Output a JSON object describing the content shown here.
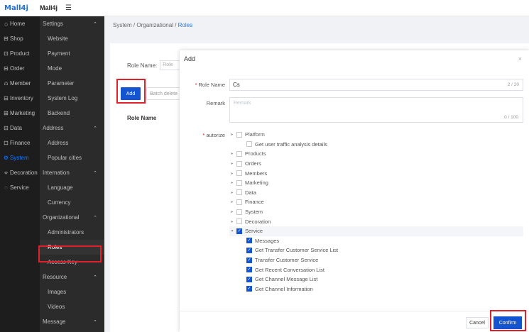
{
  "header": {
    "logo": "Mall4j",
    "brand": "Mall4j",
    "menu_toggle_icon": "hamburger-icon"
  },
  "primary_nav": [
    {
      "icon": "⌂",
      "label": "Home"
    },
    {
      "icon": "⊟",
      "label": "Shop"
    },
    {
      "icon": "⊡",
      "label": "Product"
    },
    {
      "icon": "⊟",
      "label": "Order"
    },
    {
      "icon": "⍝",
      "label": "Member"
    },
    {
      "icon": "⊟",
      "label": "Inventory"
    },
    {
      "icon": "⊞",
      "label": "Marketing"
    },
    {
      "icon": "⊟",
      "label": "Data"
    },
    {
      "icon": "⊡",
      "label": "Finance"
    },
    {
      "icon": "⚙",
      "label": "System"
    },
    {
      "icon": "⟡",
      "label": "Decoration"
    },
    {
      "icon": "◌",
      "label": "Service"
    }
  ],
  "secondary_nav": [
    {
      "type": "group",
      "label": "Settings"
    },
    {
      "type": "sub",
      "label": "Website"
    },
    {
      "type": "sub",
      "label": "Payment"
    },
    {
      "type": "sub",
      "label": "Mode"
    },
    {
      "type": "sub",
      "label": "Parameter"
    },
    {
      "type": "sub",
      "label": "System Log"
    },
    {
      "type": "sub",
      "label": "Backend"
    },
    {
      "type": "group",
      "label": "Address"
    },
    {
      "type": "sub",
      "label": "Address"
    },
    {
      "type": "sub",
      "label": "Popular cities"
    },
    {
      "type": "group",
      "label": "Internation"
    },
    {
      "type": "sub",
      "label": "Language"
    },
    {
      "type": "sub",
      "label": "Currency"
    },
    {
      "type": "group",
      "label": "Organizational"
    },
    {
      "type": "sub",
      "label": "Administrators"
    },
    {
      "type": "sub",
      "label": "Roles"
    },
    {
      "type": "sub",
      "label": "Access Key"
    },
    {
      "type": "group",
      "label": "Resource"
    },
    {
      "type": "sub",
      "label": "Images"
    },
    {
      "type": "sub",
      "label": "Videos"
    },
    {
      "type": "group",
      "label": "Message"
    }
  ],
  "breadcrumb": {
    "part1": "System",
    "sep": "/",
    "part2": "Organizational",
    "part3": "Roles"
  },
  "page": {
    "search_label": "Role Name:",
    "search_placeholder": "Role",
    "add_label": "Add",
    "batch_delete_label": "Batch delete",
    "col_role_name": "Role Name"
  },
  "dialog": {
    "title": "Add",
    "close_icon": "×",
    "role_name_label": "Role Name",
    "role_name_value": "Cs",
    "role_name_count": "2 / 20",
    "remark_label": "Remark",
    "remark_placeholder": "Remark",
    "remark_count": "0 / 100",
    "authorize_label": "autorize",
    "tree": [
      {
        "label": "Platform",
        "level": 0,
        "arrow": "▸",
        "checked": false
      },
      {
        "label": "Get user traffic analysis details",
        "level": 1,
        "arrow": "",
        "checked": false
      },
      {
        "label": "Products",
        "level": 0,
        "arrow": "▸",
        "checked": false
      },
      {
        "label": "Orders",
        "level": 0,
        "arrow": "▸",
        "checked": false
      },
      {
        "label": "Members",
        "level": 0,
        "arrow": "▸",
        "checked": false
      },
      {
        "label": "Marketing",
        "level": 0,
        "arrow": "▸",
        "checked": false
      },
      {
        "label": "Data",
        "level": 0,
        "arrow": "▸",
        "checked": false
      },
      {
        "label": "Finance",
        "level": 0,
        "arrow": "▸",
        "checked": false
      },
      {
        "label": "System",
        "level": 0,
        "arrow": "▸",
        "checked": false
      },
      {
        "label": "Decoration",
        "level": 0,
        "arrow": "▸",
        "checked": false
      },
      {
        "label": "Service",
        "level": 0,
        "arrow": "▾",
        "checked": true
      },
      {
        "label": "Messages",
        "level": 1,
        "arrow": "",
        "checked": true
      },
      {
        "label": "Get Transfer Customer Service List",
        "level": 1,
        "arrow": "",
        "checked": true
      },
      {
        "label": "Transfer Customer Service",
        "level": 1,
        "arrow": "",
        "checked": true
      },
      {
        "label": "Get Recent Conversation List",
        "level": 1,
        "arrow": "",
        "checked": true
      },
      {
        "label": "Get Channel Message List",
        "level": 1,
        "arrow": "",
        "checked": true
      },
      {
        "label": "Get Channel Information",
        "level": 1,
        "arrow": "",
        "checked": true
      }
    ],
    "cancel_label": "Cancel",
    "confirm_label": "Confirm"
  },
  "colors": {
    "primary": "#1554d1",
    "highlight": "#e0202a",
    "sidebar_dark": "#1d1d1d",
    "sidebar_secondary": "#2b2b2b"
  }
}
